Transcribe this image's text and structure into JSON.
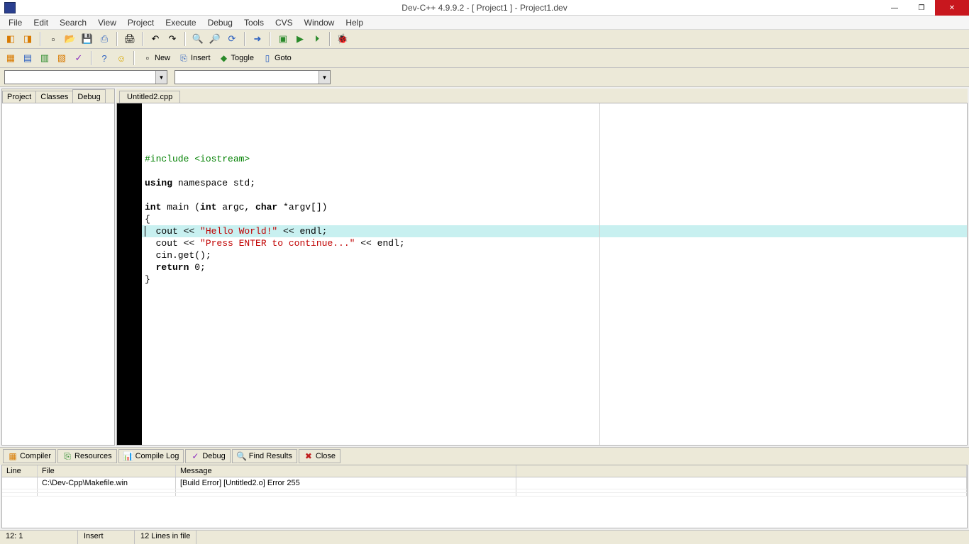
{
  "title": "Dev-C++ 4.9.9.2  -  [ Project1 ] - Project1.dev",
  "menu": [
    "File",
    "Edit",
    "Search",
    "View",
    "Project",
    "Execute",
    "Debug",
    "Tools",
    "CVS",
    "Window",
    "Help"
  ],
  "toolbar2": {
    "new": "New",
    "insert": "Insert",
    "toggle": "Toggle",
    "goto": "Goto"
  },
  "left_tabs": [
    "Project",
    "Classes",
    "Debug"
  ],
  "editor_tab": "Untitled2.cpp",
  "code": {
    "l1": "#include <iostream>",
    "l3a": "using",
    "l3b": " namespace std;",
    "l5a": "int",
    "l5b": " main (",
    "l5c": "int",
    "l5d": " argc, ",
    "l5e": "char",
    "l5f": " *argv[])",
    "l6": "{",
    "l7a": "  cout << ",
    "l7b": "\"Hello World!\"",
    "l7c": " << endl;",
    "l8a": "  cout << ",
    "l8b": "\"Press ENTER to continue...\"",
    "l8c": " << endl;",
    "l9": "  cin.get();",
    "l10a": "  return",
    "l10b": " 0;",
    "l11": "}"
  },
  "bottom_tabs": {
    "compiler": "Compiler",
    "resources": "Resources",
    "compile_log": "Compile Log",
    "debug": "Debug",
    "find": "Find Results",
    "close": "Close"
  },
  "msg_headers": {
    "line": "Line",
    "file": "File",
    "msg": "Message"
  },
  "msg_row": {
    "line": "",
    "file": "C:\\Dev-Cpp\\Makefile.win",
    "msg": "[Build Error]  [Untitled2.o] Error 255"
  },
  "status": {
    "pos": "12: 1",
    "mode": "Insert",
    "lines": "12 Lines in file"
  }
}
